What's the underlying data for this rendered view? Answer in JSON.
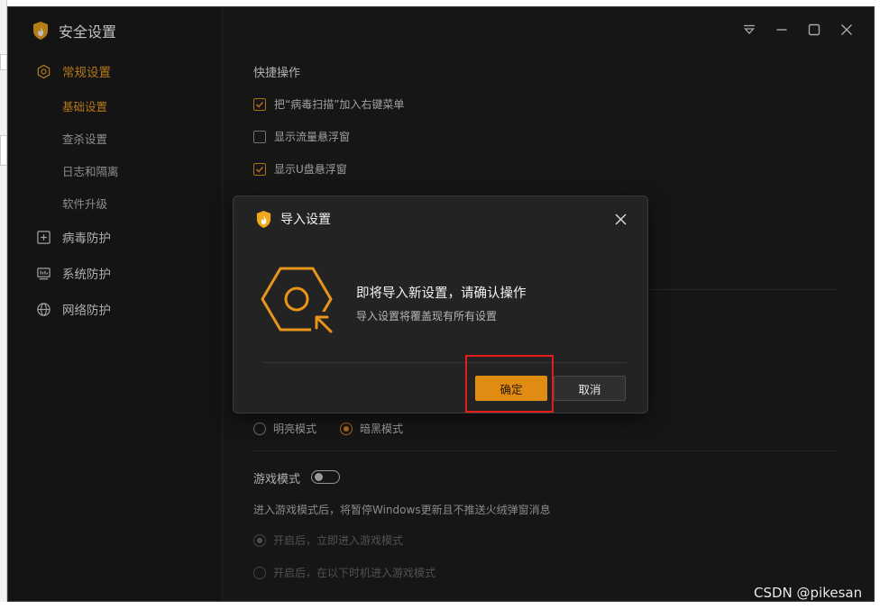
{
  "app": {
    "title": "安全设置"
  },
  "sidebar": {
    "general": "常规设置",
    "sub_items": [
      "基础设置",
      "查杀设置",
      "日志和隔离",
      "软件升级"
    ],
    "virus": "病毒防护",
    "system": "系统防护",
    "network": "网络防护"
  },
  "main": {
    "quick_ops_title": "快捷操作",
    "options": [
      {
        "label": "把“病毒扫描”加入右键菜单",
        "checked": true
      },
      {
        "label": "显示流量悬浮窗",
        "checked": false
      },
      {
        "label": "显示U盘悬浮窗",
        "checked": true
      }
    ],
    "theme_light": "明亮模式",
    "theme_dark": "暗黑模式",
    "game_title": "游戏模式",
    "game_desc": "进入游戏模式后，将暂停Windows更新且不推送火绒弹窗消息",
    "game_opt1": "开启后，立即进入游戏模式",
    "game_opt2": "开启后，在以下时机进入游戏模式"
  },
  "dialog": {
    "title": "导入设置",
    "message": "即将导入新设置，请确认操作",
    "sub": "导入设置将覆盖现有所有设置",
    "ok": "确定",
    "cancel": "取消"
  },
  "watermark": "CSDN @pikesan",
  "colors": {
    "accent": "#e8951a",
    "highlight": "#e21e1e"
  }
}
